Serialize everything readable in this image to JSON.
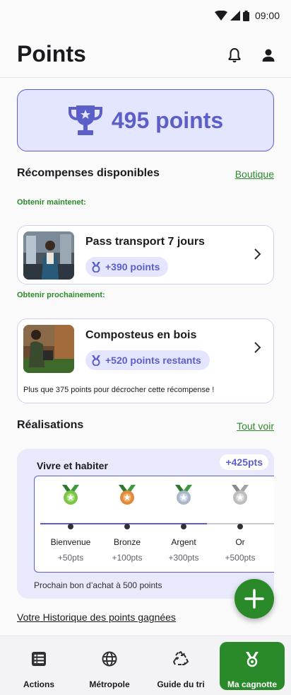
{
  "status_bar": {
    "time": "09:00"
  },
  "header": {
    "title": "Points"
  },
  "points_summary": {
    "value": "495 points"
  },
  "rewards": {
    "title": "Récompenses disponibles",
    "link": "Boutique",
    "now_label": "Obtenir maintenet:",
    "next_label": "Obtenir prochainement:",
    "items": [
      {
        "name": "Pass transport 7 jours",
        "points": "+390 points"
      },
      {
        "name": "Composteus en bois",
        "points": "+520 points restants",
        "note": "Plus que 375 points pour décrocher cette récompense !"
      }
    ]
  },
  "achievements": {
    "title": "Réalisations",
    "link": "Tout voir",
    "category": "Vivre et habiter",
    "badge": "+425pts",
    "progress_levels_reached": 3,
    "levels": [
      {
        "name": "Bienvenue",
        "pts": "+50pts",
        "color": "#7cc444"
      },
      {
        "name": "Bronze",
        "pts": "+100pts",
        "color": "#e0893a"
      },
      {
        "name": "Argent",
        "pts": "+300pts",
        "color": "#a9b7c9"
      },
      {
        "name": "Or",
        "pts": "+500pts",
        "color": "#bdbdbd"
      }
    ],
    "next": "Prochain bon d’achat à 500 points"
  },
  "history_link": "Votre Historique des points gagnées",
  "bottom_nav": [
    {
      "label": "Actions",
      "icon": "list-icon"
    },
    {
      "label": "Métropole",
      "icon": "globe-icon"
    },
    {
      "label": "Guide du tri",
      "icon": "recycle-icon"
    },
    {
      "label": "Ma cagnotte",
      "icon": "medal-icon"
    }
  ],
  "colors": {
    "primary": "#5b5fc7",
    "green": "#2a8a2a",
    "card_bg": "#e4e6ff"
  }
}
